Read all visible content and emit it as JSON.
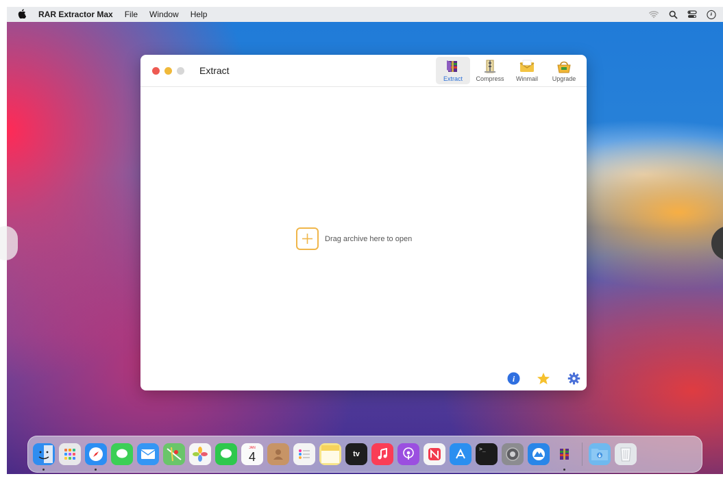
{
  "menubar": {
    "apple_icon": "apple-icon",
    "app_name": "RAR Extractor Max",
    "items": [
      "File",
      "Window",
      "Help"
    ],
    "status_icons": [
      "wifi-icon",
      "search-icon",
      "control-center-icon",
      "clock-icon"
    ]
  },
  "window": {
    "title": "Extract",
    "toolbar": [
      {
        "label": "Extract",
        "icon": "extract-icon",
        "active": true
      },
      {
        "label": "Compress",
        "icon": "compress-icon",
        "active": false
      },
      {
        "label": "Winmail",
        "icon": "winmail-icon",
        "active": false
      },
      {
        "label": "Upgrade",
        "icon": "upgrade-icon",
        "active": false
      }
    ],
    "drop_text": "Drag archive here to open",
    "bottom_icons": [
      "info-icon",
      "star-icon",
      "gear-icon"
    ]
  },
  "dock": {
    "apps": [
      {
        "name": "Finder",
        "icon": "finder-icon",
        "color": "#2f8df0",
        "running": true
      },
      {
        "name": "Launchpad",
        "icon": "launchpad-icon",
        "color": "#e8e8ea",
        "running": false
      },
      {
        "name": "Safari",
        "icon": "safari-icon",
        "color": "#2b8ef3",
        "running": true
      },
      {
        "name": "Messages",
        "icon": "messages-icon",
        "color": "#3ccf56",
        "running": false
      },
      {
        "name": "Mail",
        "icon": "mail-icon",
        "color": "#3596f4",
        "running": false
      },
      {
        "name": "Maps",
        "icon": "maps-icon",
        "color": "#6ac56a",
        "running": false
      },
      {
        "name": "Photos",
        "icon": "photos-icon",
        "color": "#f6f6f6",
        "running": false
      },
      {
        "name": "FaceTime",
        "icon": "facetime-icon",
        "color": "#2ec84d",
        "running": false
      },
      {
        "name": "Calendar",
        "icon": "calendar-icon",
        "color": "#fafafa",
        "running": false
      },
      {
        "name": "Contacts",
        "icon": "contacts-icon",
        "color": "#c79466",
        "running": false
      },
      {
        "name": "Reminders",
        "icon": "reminders-icon",
        "color": "#f4f4f4",
        "running": false
      },
      {
        "name": "Notes",
        "icon": "notes-icon",
        "color": "#f7e58a",
        "running": false
      },
      {
        "name": "TV",
        "icon": "tv-icon",
        "color": "#1d1d1f",
        "running": false
      },
      {
        "name": "Music",
        "icon": "music-icon",
        "color": "#fa3d56",
        "running": false
      },
      {
        "name": "Podcasts",
        "icon": "podcasts-icon",
        "color": "#9b4fe0",
        "running": false
      },
      {
        "name": "News",
        "icon": "news-icon",
        "color": "#f5f5f5",
        "running": false
      },
      {
        "name": "App Store",
        "icon": "app-store-icon",
        "color": "#2a8ff0",
        "running": false
      },
      {
        "name": "Terminal",
        "icon": "terminal-icon",
        "color": "#1b1b1b",
        "running": false
      },
      {
        "name": "System Preferences",
        "icon": "system-preferences-icon",
        "color": "#8c8c90",
        "running": false
      },
      {
        "name": "Monterey Installer",
        "icon": "installer-icon",
        "color": "#2a86e8",
        "running": false
      },
      {
        "name": "RAR Extractor Max",
        "icon": "rar-extractor-icon",
        "color": "#7a3fb8",
        "running": true
      }
    ],
    "extras": [
      {
        "name": "Downloads",
        "icon": "downloads-folder-icon",
        "color": "#6fb9ef"
      },
      {
        "name": "Trash",
        "icon": "trash-icon",
        "color": "#e3e6ea"
      }
    ]
  },
  "calendar_day": "4",
  "calendar_month": "JAN",
  "tv_label": "tv",
  "accent": "#f0b64a"
}
